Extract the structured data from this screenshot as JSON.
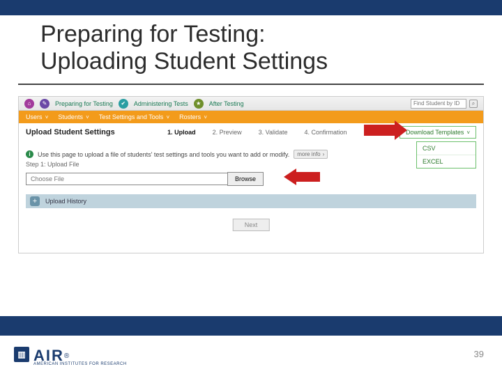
{
  "slide": {
    "title_line1": "Preparing for Testing:",
    "title_line2": "Uploading Student Settings",
    "page_number": "39"
  },
  "logo": {
    "mark_text": "▥",
    "name": "AIR",
    "reg": "®",
    "subtitle": "AMERICAN INSTITUTES FOR RESEARCH"
  },
  "tabs": {
    "preparing": "Preparing for Testing",
    "administering": "Administering Tests",
    "after": "After Testing"
  },
  "search": {
    "placeholder": "Find Student by ID"
  },
  "subnav": {
    "users": "Users",
    "students": "Students",
    "tools": "Test Settings and Tools",
    "rosters": "Rosters"
  },
  "section": {
    "title": "Upload Student Settings",
    "download_label": "Download Templates",
    "dropdown": {
      "csv": "CSV",
      "excel": "EXCEL"
    }
  },
  "steps": {
    "s1": "1. Upload",
    "s2": "2. Preview",
    "s3": "3. Validate",
    "s4": "4. Confirmation"
  },
  "info": {
    "text": "Use this page to upload a file of students' test settings and tools you want to add or modify.",
    "more": "more info"
  },
  "upload": {
    "step_label": "Step 1: Upload File",
    "choose_placeholder": "Choose File",
    "browse": "Browse",
    "history": "Upload History",
    "next": "Next"
  }
}
